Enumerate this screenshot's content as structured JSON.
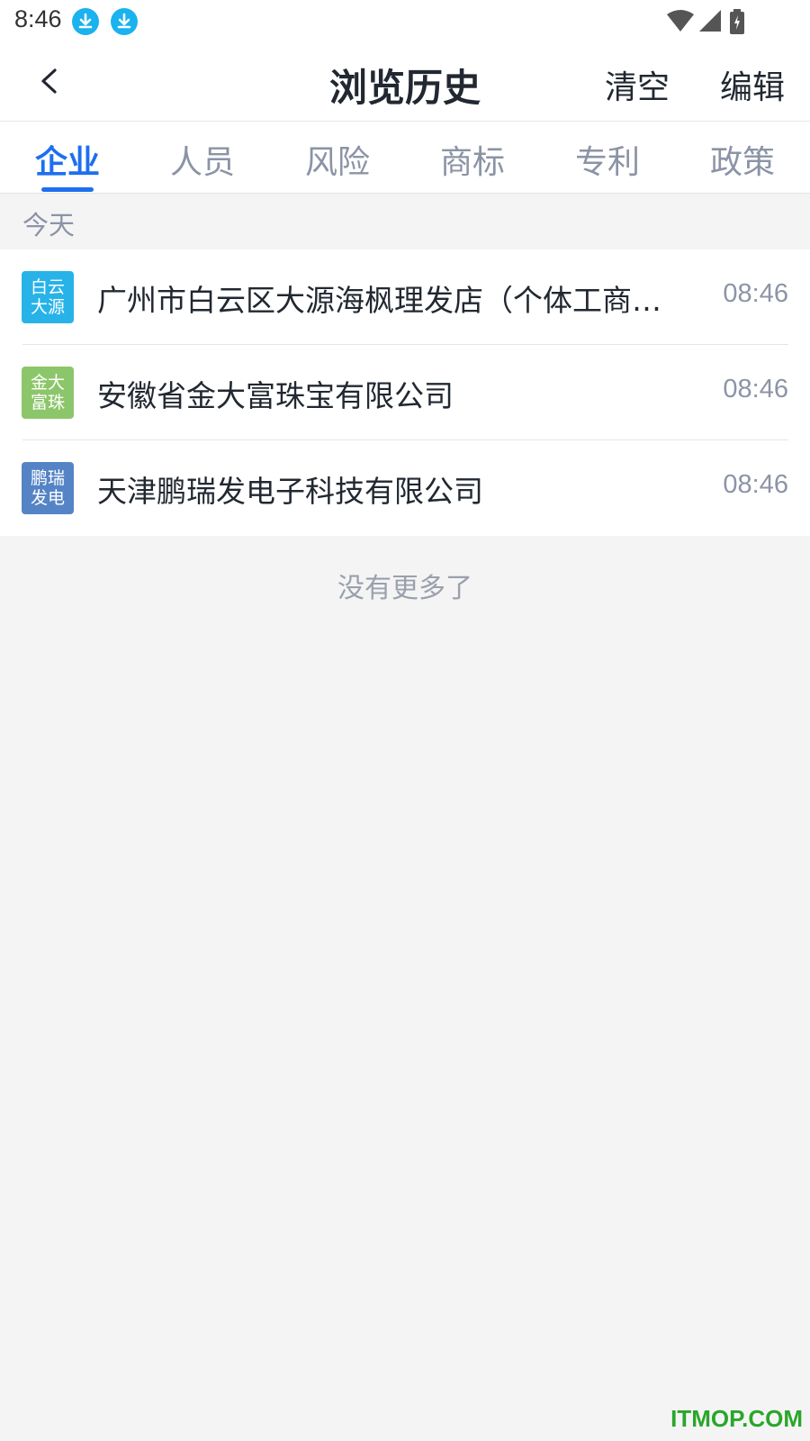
{
  "status_bar": {
    "time": "8:46",
    "left_icons": [
      "download-icon",
      "download-icon"
    ],
    "right_icons": [
      "wifi-icon",
      "signal-icon",
      "battery-charging-icon"
    ]
  },
  "header": {
    "title": "浏览历史",
    "back_icon": "chevron-left-icon",
    "clear_label": "清空",
    "edit_label": "编辑"
  },
  "tabs": [
    {
      "label": "企业",
      "active": true
    },
    {
      "label": "人员",
      "active": false
    },
    {
      "label": "风险",
      "active": false
    },
    {
      "label": "商标",
      "active": false
    },
    {
      "label": "专利",
      "active": false
    },
    {
      "label": "政策",
      "active": false
    }
  ],
  "section": {
    "label": "今天"
  },
  "history_items": [
    {
      "avatar_top": "白云",
      "avatar_bottom": "大源",
      "avatar_color": "#27b3e8",
      "name": "广州市白云区大源海枫理发店（个体工商户）",
      "time": "08:46"
    },
    {
      "avatar_top": "金大",
      "avatar_bottom": "富珠",
      "avatar_color": "#8cc66a",
      "name": "安徽省金大富珠宝有限公司",
      "time": "08:46"
    },
    {
      "avatar_top": "鹏瑞",
      "avatar_bottom": "发电",
      "avatar_color": "#5584c6",
      "name": "天津鹏瑞发电子科技有限公司",
      "time": "08:46"
    }
  ],
  "footer": {
    "no_more": "没有更多了"
  },
  "watermark": "ITMOP.COM",
  "colors": {
    "accent": "#1e6ff0",
    "background": "#f4f4f5",
    "title_text": "#222831",
    "muted_text": "#8c94a6"
  }
}
